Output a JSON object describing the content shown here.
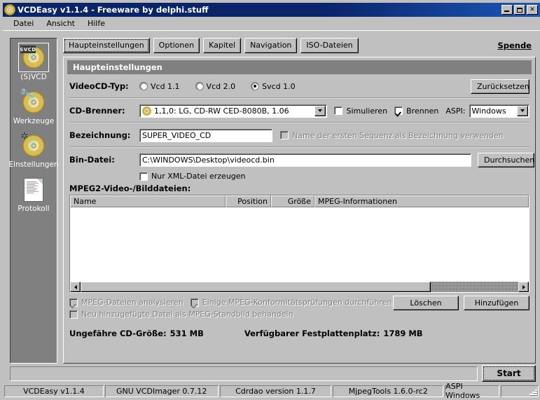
{
  "window": {
    "title": "VCDEasy v1.1.4 - Freeware by delphi.stuff",
    "icon": "cd-icon",
    "minimize_label": "_",
    "maximize_label": "□",
    "close_label": "×"
  },
  "menu": {
    "items": [
      {
        "label": "Datei"
      },
      {
        "label": "Ansicht"
      },
      {
        "label": "Hilfe"
      }
    ]
  },
  "sidebar": {
    "items": [
      {
        "label": "(S)VCD",
        "icon": "svcd-disc-icon",
        "badge": "SVCD",
        "selected": true
      },
      {
        "label": "Werkzeuge",
        "icon": "tools-disc-icon",
        "selected": false
      },
      {
        "label": "Einstellungen",
        "icon": "settings-disc-icon",
        "selected": false
      },
      {
        "label": "Protokoll",
        "icon": "log-document-icon",
        "selected": false
      }
    ]
  },
  "tabs": [
    {
      "label": "Haupteinstellungen",
      "active": true
    },
    {
      "label": "Optionen",
      "active": false
    },
    {
      "label": "Kapitel",
      "active": false
    },
    {
      "label": "Navigation",
      "active": false
    },
    {
      "label": "ISO-Dateien",
      "active": false
    }
  ],
  "donate_link": "Spende",
  "panel": {
    "header": "Haupteinstellungen",
    "videocd_type": {
      "label": "VideoCD-Typ:",
      "options": [
        {
          "label": "Vcd 1.1",
          "selected": false
        },
        {
          "label": "Vcd 2.0",
          "selected": false
        },
        {
          "label": "Svcd 1.0",
          "selected": true
        }
      ],
      "reset_button": "Zurücksetzen"
    },
    "burner": {
      "label": "CD-Brenner:",
      "value": "1,1,0: LG, CD-RW CED-8080B, 1.06",
      "simulate": {
        "label": "Simulieren",
        "checked": false
      },
      "burn": {
        "label": "Brennen",
        "checked": true
      },
      "aspi_label": "ASPI:",
      "aspi_value": "Windows"
    },
    "volume": {
      "label": "Bezeichnung:",
      "value": "SUPER_VIDEO_CD",
      "use_first_sequence": {
        "label": "Name der ersten Sequenz als Bezeichnung verwenden",
        "checked": false,
        "disabled": true
      }
    },
    "bin_file": {
      "label": "Bin-Datei:",
      "value": "C:\\WINDOWS\\Desktop\\videocd.bin",
      "browse_button": "Durchsuchen",
      "xml_only": {
        "label": "Nur XML-Datei erzeugen",
        "checked": false
      }
    },
    "files": {
      "label": "MPEG2-Video-/Bilddateien:",
      "columns": [
        "Name",
        "Position",
        "Größe",
        "MPEG-Informationen"
      ],
      "rows": []
    },
    "file_options": [
      {
        "label": "MPEG-Dateien analysieren",
        "checked": true,
        "disabled": true
      },
      {
        "label": "Einige MPEG-Konformitätsprüfungen durchführen",
        "checked": true,
        "disabled": true
      },
      {
        "label": "Neu hinzugefügte Datei als MPEG-Standbild behandeln",
        "checked": false,
        "disabled": true
      }
    ],
    "delete_button": "Löschen",
    "add_button": "Hinzufügen",
    "cd_size_label": "Ungefähre CD-Größe:",
    "cd_size_value": "531 MB",
    "free_space_label": "Verfügbarer Festplattenplatz:",
    "free_space_value": "1789 MB"
  },
  "start_button": "Start",
  "statusbar": {
    "panels": [
      "VCDEasy v1.1.4",
      "GNU VCDImager 0.7.12",
      "Cdrdao version 1.1.7",
      "MjpegTools 1.6.0-rc2",
      "ASPI Windows"
    ]
  },
  "colors": {
    "face": "#c0c0c0",
    "titlebar": "#0a246a",
    "panel_header": "#808080",
    "sidebar": "#808080"
  }
}
